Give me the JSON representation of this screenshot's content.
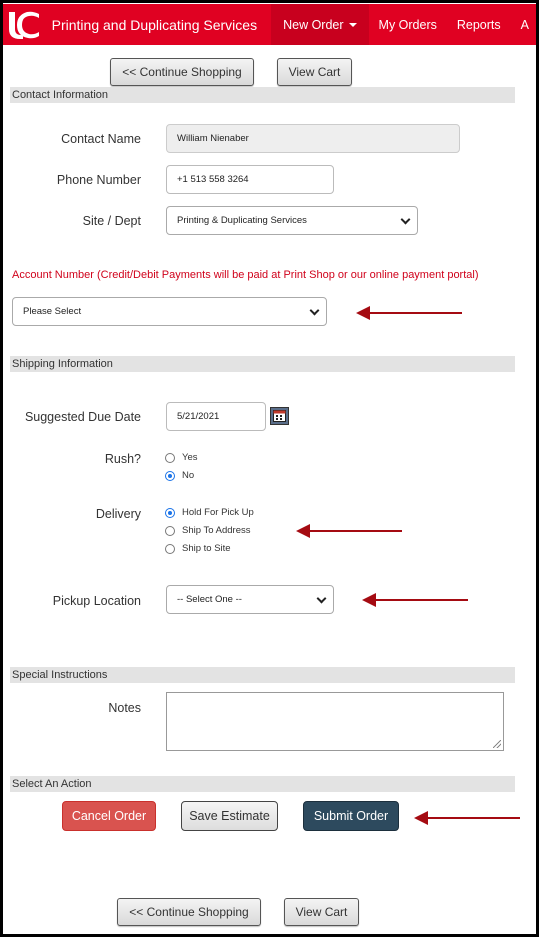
{
  "nav": {
    "brand": "Printing and Duplicating Services",
    "items": [
      "New Order",
      "My Orders",
      "Reports",
      "A"
    ]
  },
  "buttons": {
    "continue_shopping": "<< Continue Shopping",
    "view_cart": "View Cart"
  },
  "contact": {
    "section_title": "Contact Information",
    "name_label": "Contact Name",
    "name_value": "William Nienaber",
    "phone_label": "Phone Number",
    "phone_value": "+1 513 558 3264",
    "site_label": "Site / Dept",
    "site_value": "Printing & Duplicating Services"
  },
  "account": {
    "label": "Account Number (Credit/Debit Payments will be paid at Print Shop or our online payment portal)",
    "value": "Please Select"
  },
  "shipping": {
    "section_title": "Shipping Information",
    "due_label": "Suggested Due Date",
    "due_value": "5/21/2021",
    "rush_label": "Rush?",
    "rush_options": [
      "Yes",
      "No"
    ],
    "delivery_label": "Delivery",
    "delivery_options": [
      "Hold For Pick Up",
      "Ship To Address",
      "Ship to Site"
    ],
    "pickup_label": "Pickup Location",
    "pickup_value": "-- Select One --"
  },
  "special": {
    "section_title": "Special Instructions",
    "notes_label": "Notes",
    "notes_value": ""
  },
  "action": {
    "section_title": "Select An Action",
    "cancel": "Cancel Order",
    "save": "Save Estimate",
    "submit": "Submit Order"
  },
  "colors": {
    "brand_red": "#e00122",
    "arrow": "#a50b12",
    "cancel": "#d9534f",
    "submit": "#2d4a5e",
    "account_label": "#d0021b"
  }
}
